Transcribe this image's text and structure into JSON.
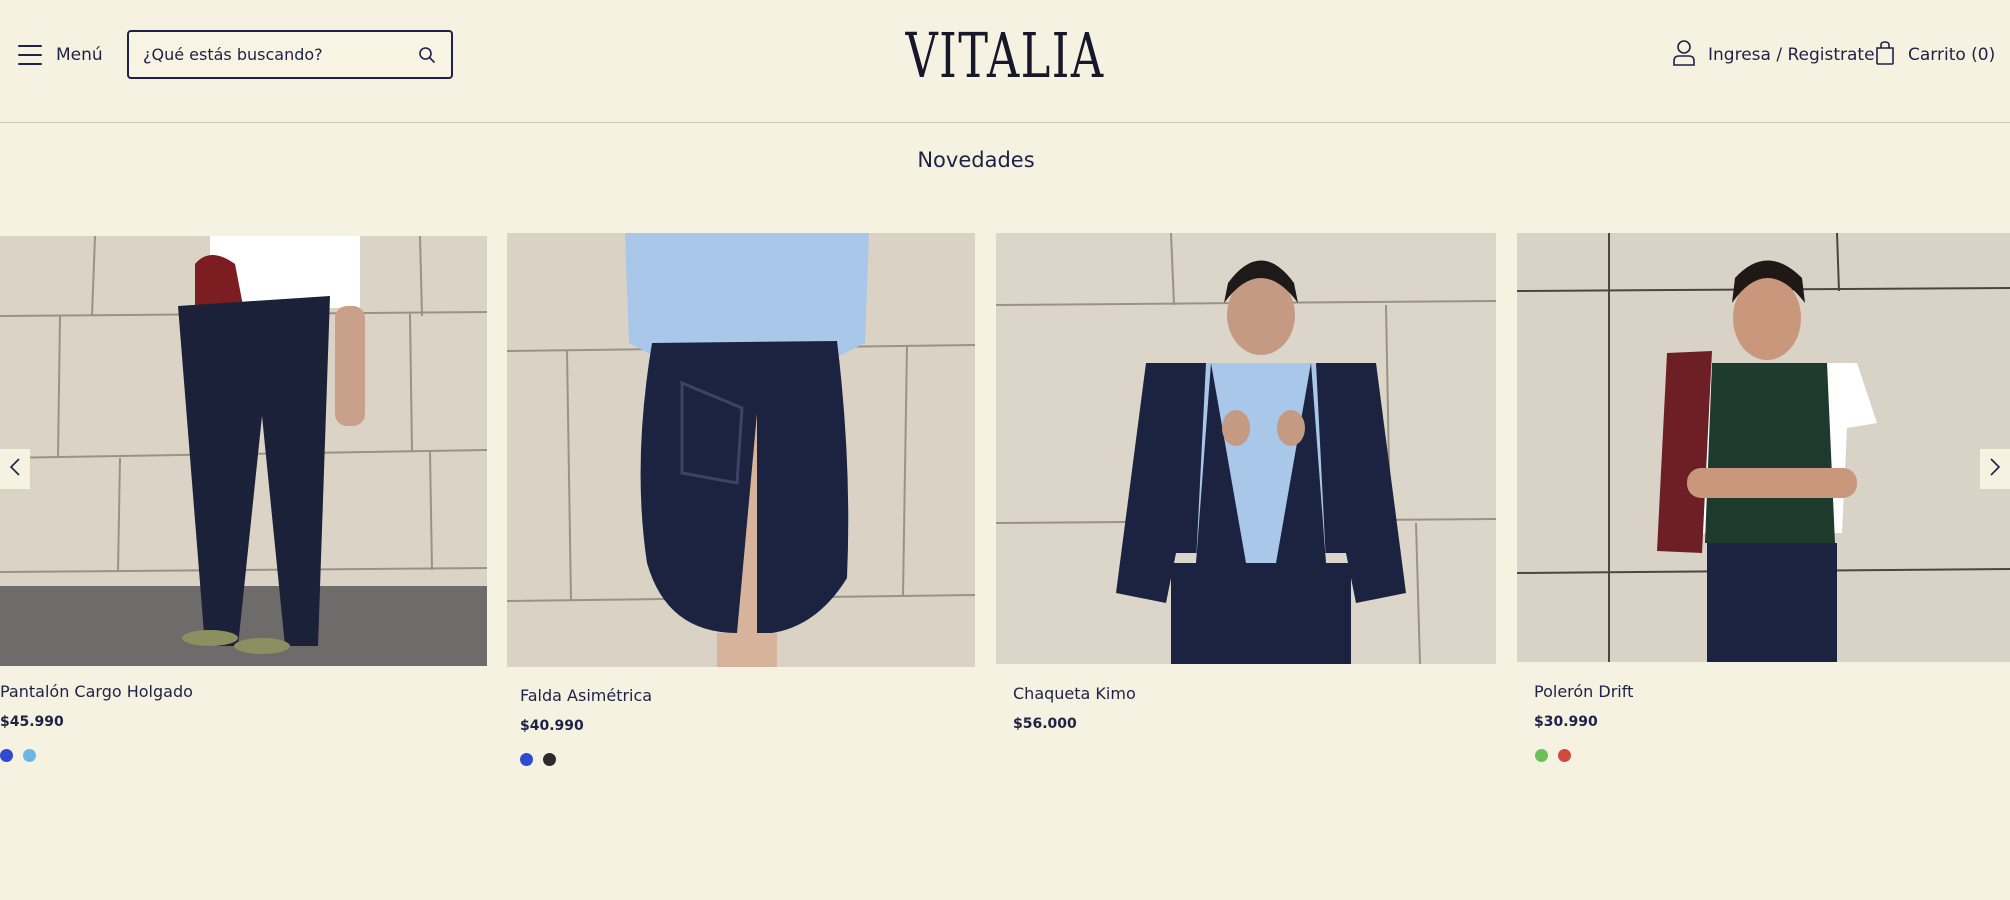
{
  "header": {
    "menu_label": "Menú",
    "search_placeholder": "¿Qué estás buscando?",
    "logo": "VITALIA",
    "account_label": "Ingresa / Registrate",
    "cart_label": "Carrito (0)"
  },
  "section": {
    "title": "Novedades"
  },
  "products": [
    {
      "name": "Pantalón Cargo Holgado",
      "price": "$45.990",
      "swatches": [
        "#2f4ad0",
        "#6cb6e6"
      ]
    },
    {
      "name": "Falda Asimétrica",
      "price": "$40.990",
      "swatches": [
        "#2f4ad0",
        "#2b2b2b"
      ]
    },
    {
      "name": "Chaqueta Kimo",
      "price": "$56.000",
      "swatches": []
    },
    {
      "name": "Polerón Drift",
      "price": "$30.990",
      "swatches": [
        "#6cc05a",
        "#cf4b3f"
      ]
    }
  ],
  "colors": {
    "background": "#f5f2e1",
    "text": "#1d2246",
    "wall": "#dcd5c8",
    "navy": "#1c2340"
  },
  "icons": {
    "menu": "hamburger-icon",
    "search": "search-icon",
    "account": "user-icon",
    "cart": "shopping-bag-icon",
    "prev": "chevron-left-icon",
    "next": "chevron-right-icon"
  }
}
